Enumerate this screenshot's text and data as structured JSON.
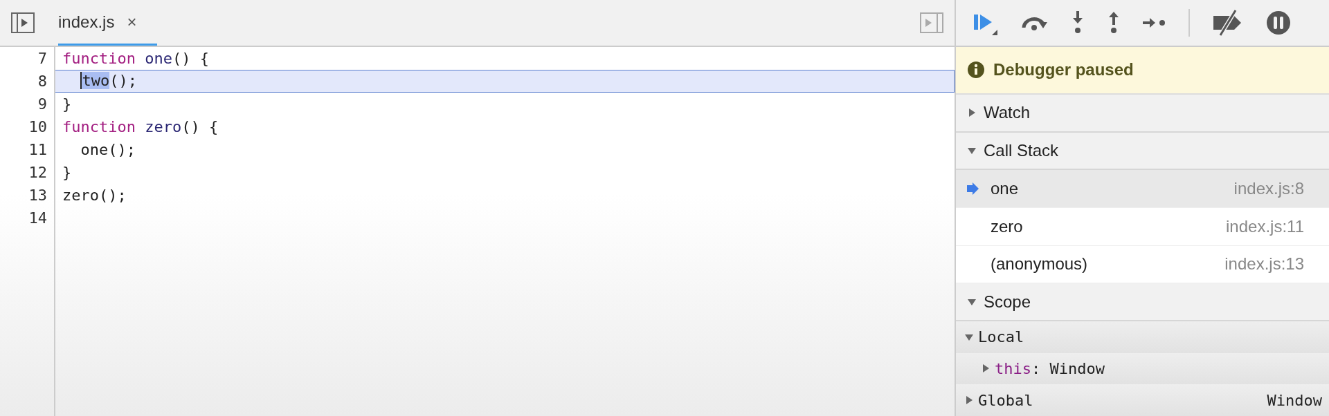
{
  "editor": {
    "tabs": [
      {
        "label": "index.js",
        "close": "×",
        "selected": true
      }
    ],
    "lines": [
      {
        "number": "7",
        "current": false,
        "indented": false,
        "tokens": [
          {
            "text": "function",
            "kind": "keyword"
          },
          {
            "text": "one",
            "kind": "name"
          },
          {
            "text": "() {",
            "kind": "plain"
          }
        ]
      },
      {
        "number": "8",
        "current": true,
        "indented": true,
        "tokens": [
          {
            "text": "two",
            "kind": "match"
          },
          {
            "text": "();",
            "kind": "plain"
          }
        ]
      },
      {
        "number": "9",
        "current": false,
        "indented": false,
        "tokens": [
          {
            "text": "}",
            "kind": "plain"
          }
        ]
      },
      {
        "number": "10",
        "current": false,
        "indented": false,
        "tokens": [
          {
            "text": "function",
            "kind": "keyword"
          },
          {
            "text": "zero",
            "kind": "name"
          },
          {
            "text": "() {",
            "kind": "plain"
          }
        ]
      },
      {
        "number": "11",
        "current": false,
        "indented": true,
        "tokens": [
          {
            "text": "one();",
            "kind": "plain"
          }
        ]
      },
      {
        "number": "12",
        "current": false,
        "indented": false,
        "tokens": [
          {
            "text": "}",
            "kind": "plain"
          }
        ]
      },
      {
        "number": "13",
        "current": false,
        "indented": false,
        "tokens": [
          {
            "text": "zero();",
            "kind": "plain"
          }
        ]
      },
      {
        "number": "14",
        "current": false
      }
    ]
  },
  "debugger": {
    "banner": "Debugger paused",
    "watch": {
      "title": "Watch",
      "expanded": false
    },
    "call_stack": {
      "title": "Call Stack",
      "expanded": true,
      "frames": [
        {
          "name": "one",
          "location": "index.js:8",
          "selected": true
        },
        {
          "name": "zero",
          "location": "index.js:11",
          "selected": false
        },
        {
          "name": "(anonymous)",
          "location": "index.js:13",
          "selected": false
        }
      ]
    },
    "scope": {
      "title": "Scope",
      "expanded": true,
      "groups": [
        {
          "name": "Local",
          "expanded": true,
          "props": [
            {
              "key": "this",
              "separator": ":",
              "value": "Window"
            }
          ]
        },
        {
          "name": "Global",
          "expanded": false,
          "value": "Window"
        }
      ]
    }
  }
}
